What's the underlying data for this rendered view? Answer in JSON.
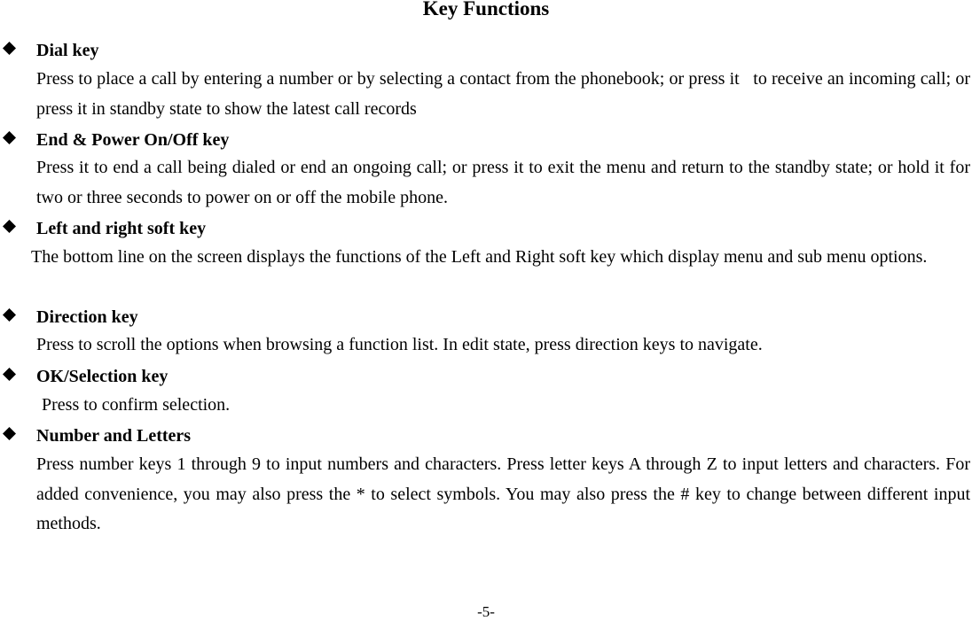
{
  "page": {
    "title": "Key Functions",
    "page_number": "-5-"
  },
  "sections": [
    {
      "heading": "Dial key",
      "body": "Press to place a call by entering a number or by selecting a contact from the phonebook; or press it   to receive an incoming call; or press it in standby state to show the latest call records"
    },
    {
      "heading": "End & Power On/Off key",
      "body": "Press it to end a call being dialed or end an ongoing call; or press it to exit the menu and return to the standby state; or hold it for two or three seconds to power on or off the mobile phone."
    },
    {
      "heading": "Left and right soft key",
      "body": "The bottom line on the screen displays the functions of the Left and Right soft key which display menu and sub menu options."
    },
    {
      "heading": "Direction key",
      "body": "Press to scroll the options when browsing a function list. In edit state, press direction keys to navigate."
    },
    {
      "heading": "OK/Selection key",
      "body": "Press to confirm selection."
    },
    {
      "heading": "Number and Letters",
      "body": "Press number keys 1 through 9 to input numbers and characters. Press letter keys A through Z to input letters and characters. For added convenience, you may also press the * to select symbols. You may also press the # key to change between different input methods."
    }
  ],
  "icons": {
    "bullet": "diamond-bullet-icon"
  }
}
